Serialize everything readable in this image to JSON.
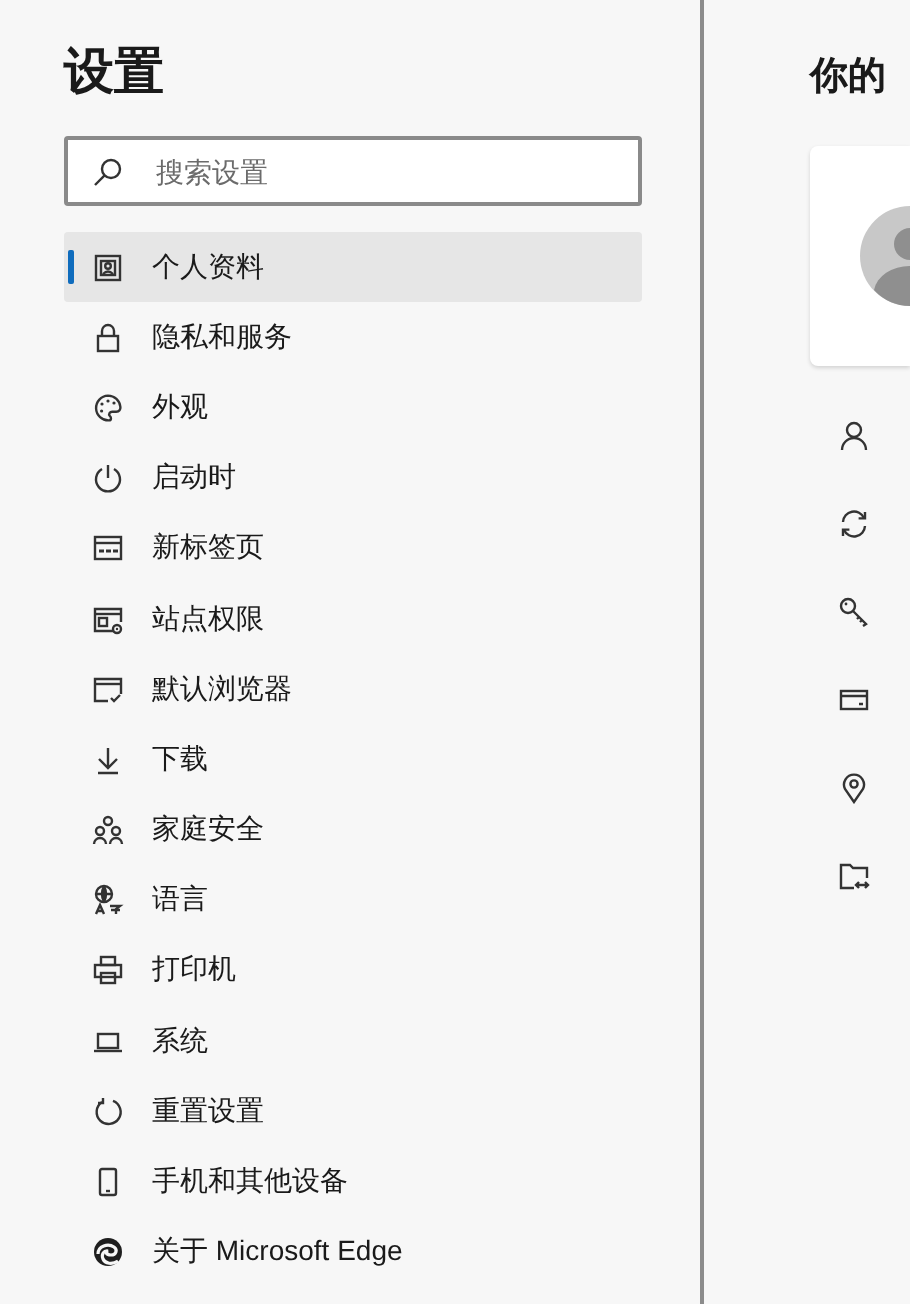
{
  "sidebar": {
    "title": "设置",
    "search": {
      "placeholder": "搜索设置"
    },
    "items": [
      {
        "label": "个人资料",
        "selected": true
      },
      {
        "label": "隐私和服务",
        "selected": false
      },
      {
        "label": "外观",
        "selected": false
      },
      {
        "label": "启动时",
        "selected": false
      },
      {
        "label": "新标签页",
        "selected": false
      },
      {
        "label": "站点权限",
        "selected": false
      },
      {
        "label": "默认浏览器",
        "selected": false
      },
      {
        "label": "下载",
        "selected": false
      },
      {
        "label": "家庭安全",
        "selected": false
      },
      {
        "label": "语言",
        "selected": false
      },
      {
        "label": "打印机",
        "selected": false
      },
      {
        "label": "系统",
        "selected": false
      },
      {
        "label": "重置设置",
        "selected": false
      },
      {
        "label": "手机和其他设备",
        "selected": false
      },
      {
        "label": "关于 Microsoft Edge",
        "selected": false
      }
    ]
  },
  "main": {
    "title": "你的"
  }
}
